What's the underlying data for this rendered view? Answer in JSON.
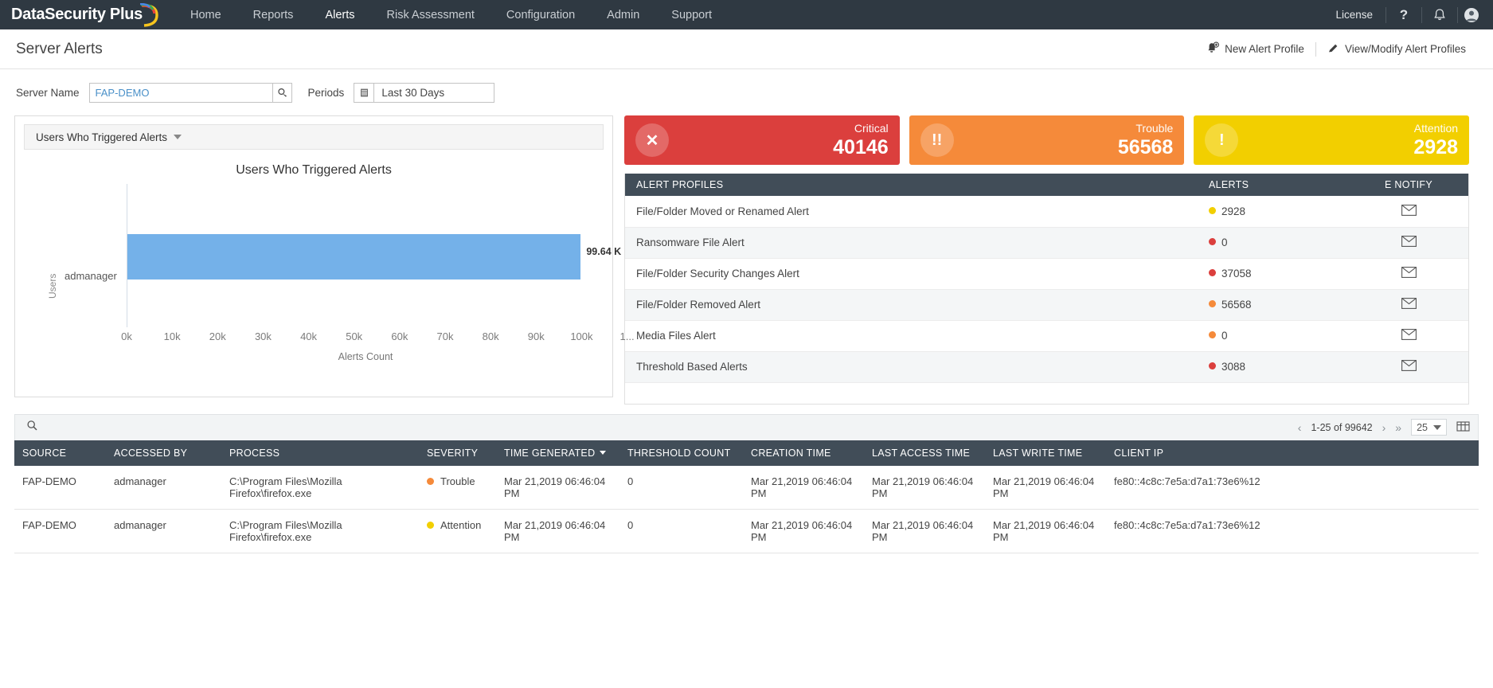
{
  "topnav": {
    "brand": "DataSecurity Plus",
    "items": [
      {
        "label": "Home",
        "active": false
      },
      {
        "label": "Reports",
        "active": false
      },
      {
        "label": "Alerts",
        "active": true
      },
      {
        "label": "Risk Assessment",
        "active": false
      },
      {
        "label": "Configuration",
        "active": false
      },
      {
        "label": "Admin",
        "active": false
      },
      {
        "label": "Support",
        "active": false
      }
    ],
    "license": "License",
    "help_icon": "question-mark-icon",
    "bell_icon": "bell-icon",
    "user_icon": "user-avatar-icon"
  },
  "page": {
    "title": "Server Alerts",
    "actions": [
      {
        "label": "New Alert Profile",
        "icon": "bell-add-icon"
      },
      {
        "label": "View/Modify Alert Profiles",
        "icon": "pencil-icon"
      }
    ]
  },
  "filters": {
    "server_name_label": "Server Name",
    "server_name_value": "FAP-DEMO",
    "server_name_placeholder": "Server Name",
    "server_pick_icon": "cursor-select-icon",
    "periods_label": "Periods",
    "periods_icon": "calendar-icon",
    "periods_value": "Last 30 Days"
  },
  "chart_panel": {
    "selector_label": "Users Who Triggered Alerts",
    "selector_icon": "chevron-down-icon"
  },
  "chart_data": {
    "type": "bar",
    "orientation": "horizontal",
    "title": "Users Who Triggered Alerts",
    "xlabel": "Alerts Count",
    "ylabel": "Users",
    "categories": [
      "admanager"
    ],
    "values": [
      99640
    ],
    "value_labels": [
      "99.64 K"
    ],
    "xlim": [
      0,
      105000
    ],
    "xticks": [
      "0k",
      "10k",
      "20k",
      "30k",
      "40k",
      "50k",
      "60k",
      "70k",
      "80k",
      "90k",
      "100k",
      "1..."
    ],
    "xtick_values": [
      0,
      10000,
      20000,
      30000,
      40000,
      50000,
      60000,
      70000,
      80000,
      90000,
      100000,
      110000
    ],
    "bar_color": "#74b1e9",
    "grid": false,
    "legend": "none"
  },
  "cards": [
    {
      "title": "Critical",
      "value": "40146",
      "color": "#db3f3d",
      "icon": "x-circle-icon",
      "glyph": "✕"
    },
    {
      "title": "Trouble",
      "value": "56568",
      "color": "#f58a3a",
      "icon": "double-exclamation-icon",
      "glyph": "!!"
    },
    {
      "title": "Attention",
      "value": "2928",
      "color": "#f2cf00",
      "icon": "exclamation-icon",
      "glyph": "!"
    }
  ],
  "profiles_table": {
    "columns": [
      "ALERT PROFILES",
      "ALERTS",
      "E NOTIFY"
    ],
    "notify_icon": "envelope-icon",
    "rows": [
      {
        "profile": "File/Folder Moved or Renamed Alert",
        "alerts": "2928",
        "severity_color": "#f2cf00"
      },
      {
        "profile": "Ransomware File Alert",
        "alerts": "0",
        "severity_color": "#db3f3d"
      },
      {
        "profile": "File/Folder Security Changes Alert",
        "alerts": "37058",
        "severity_color": "#db3f3d"
      },
      {
        "profile": "File/Folder Removed Alert",
        "alerts": "56568",
        "severity_color": "#f58a3a"
      },
      {
        "profile": "Media Files Alert",
        "alerts": "0",
        "severity_color": "#f58a3a"
      },
      {
        "profile": "Threshold Based Alerts",
        "alerts": "3088",
        "severity_color": "#db3f3d"
      }
    ]
  },
  "data_table": {
    "search_icon": "search-icon",
    "pagination": {
      "prev_icon": "chevron-left-icon",
      "next_icon": "chevron-right-icon",
      "last_icon": "double-chevron-right-icon",
      "range": "1-25 of 99642",
      "page_size": "25",
      "page_size_caret": "chevron-down-icon",
      "columns_icon": "column-settings-icon"
    },
    "columns": [
      "SOURCE",
      "ACCESSED BY",
      "PROCESS",
      "SEVERITY",
      "TIME GENERATED",
      "THRESHOLD COUNT",
      "CREATION TIME",
      "LAST ACCESS TIME",
      "LAST WRITE TIME",
      "CLIENT IP"
    ],
    "sorted_column": "TIME GENERATED",
    "rows": [
      {
        "source": "FAP-DEMO",
        "accessed_by": "admanager",
        "process": "C:\\Program Files\\Mozilla Firefox\\firefox.exe",
        "severity": "Trouble",
        "severity_color": "#f58a3a",
        "time_generated": "Mar 21,2019 06:46:04 PM",
        "threshold_count": "0",
        "creation_time": "Mar 21,2019 06:46:04 PM",
        "last_access_time": "Mar 21,2019 06:46:04 PM",
        "last_write_time": "Mar 21,2019 06:46:04 PM",
        "client_ip": "fe80::4c8c:7e5a:d7a1:73e6%12"
      },
      {
        "source": "FAP-DEMO",
        "accessed_by": "admanager",
        "process": "C:\\Program Files\\Mozilla Firefox\\firefox.exe",
        "severity": "Attention",
        "severity_color": "#f2cf00",
        "time_generated": "Mar 21,2019 06:46:04 PM",
        "threshold_count": "0",
        "creation_time": "Mar 21,2019 06:46:04 PM",
        "last_access_time": "Mar 21,2019 06:46:04 PM",
        "last_write_time": "Mar 21,2019 06:46:04 PM",
        "client_ip": "fe80::4c8c:7e5a:d7a1:73e6%12"
      }
    ]
  }
}
